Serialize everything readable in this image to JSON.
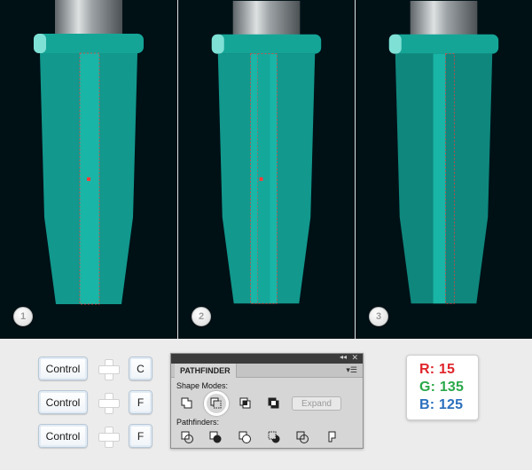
{
  "steps": [
    {
      "number": "1"
    },
    {
      "number": "2"
    },
    {
      "number": "3"
    }
  ],
  "shortcuts": [
    {
      "modifier": "Control",
      "key": "C"
    },
    {
      "modifier": "Control",
      "key": "F"
    },
    {
      "modifier": "Control",
      "key": "F"
    }
  ],
  "pathfinder": {
    "tab_label": "PATHFINDER",
    "collapse_glyph": "◂◂",
    "close_glyph": "✕",
    "menu_glyph": "▾☰",
    "shape_modes_label": "Shape Modes:",
    "pathfinders_label": "Pathfinders:",
    "expand_label": "Expand",
    "active_shape_mode": "minus-front"
  },
  "color": {
    "r_label": "R: 15",
    "g_label": "G: 135",
    "b_label": "B: 125",
    "r_color": "#e0242b",
    "g_color": "#2aa84a",
    "b_color": "#2c6fbd",
    "fill_color": "#0f877d"
  },
  "colors": {
    "background": "#001116",
    "teal_body": "#12988d",
    "teal_final": "#0f877d",
    "highlight_strip": "#19b5a6",
    "collar": "#15a597",
    "collar_highlight": "#7fe0d5",
    "selection": "#ff3a3a"
  }
}
